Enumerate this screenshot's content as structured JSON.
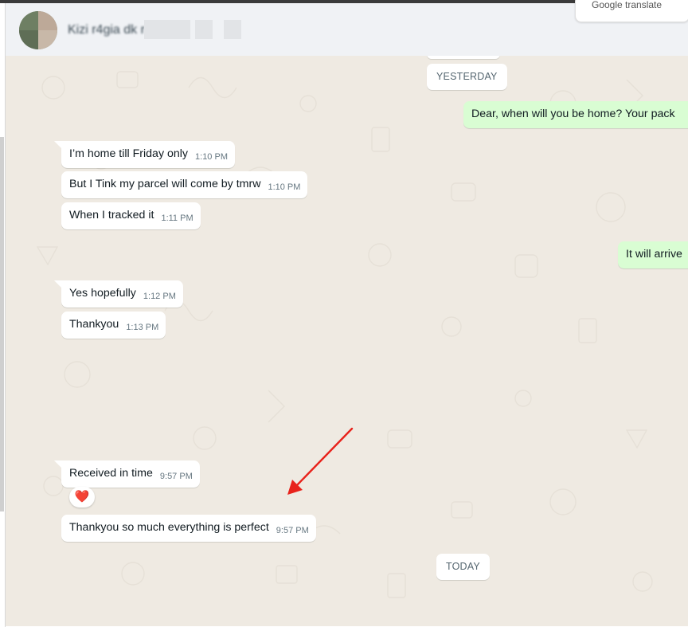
{
  "header": {
    "contact_name": "Kizi r4gia dk r",
    "translate_label": "Google translate"
  },
  "chat": {
    "date_yesterday": "YESTERDAY",
    "date_today": "TODAY",
    "outgoing": [
      {
        "text": "Dear, when will you be home? Your pack"
      },
      {
        "text": "It will arrive"
      }
    ],
    "incoming": [
      {
        "text": "I’m home till Friday only",
        "time": "1:10 PM"
      },
      {
        "text": "But I Tink my parcel will come by tmrw",
        "time": "1:10 PM"
      },
      {
        "text": "When I tracked it",
        "time": "1:11 PM"
      },
      {
        "text": "Yes hopefully",
        "time": "1:12 PM"
      },
      {
        "text": "Thankyou",
        "time": "1:13 PM"
      },
      {
        "text": "Received in time",
        "time": "9:57 PM"
      },
      {
        "text": "Thankyou so much everything is perfect",
        "time": "9:57 PM"
      }
    ],
    "reaction_emoji": "❤️"
  },
  "colors": {
    "chat_background": "#efeae2",
    "incoming_bubble": "#ffffff",
    "outgoing_bubble": "#d9fdd3",
    "annotation_arrow": "#e8221b"
  }
}
